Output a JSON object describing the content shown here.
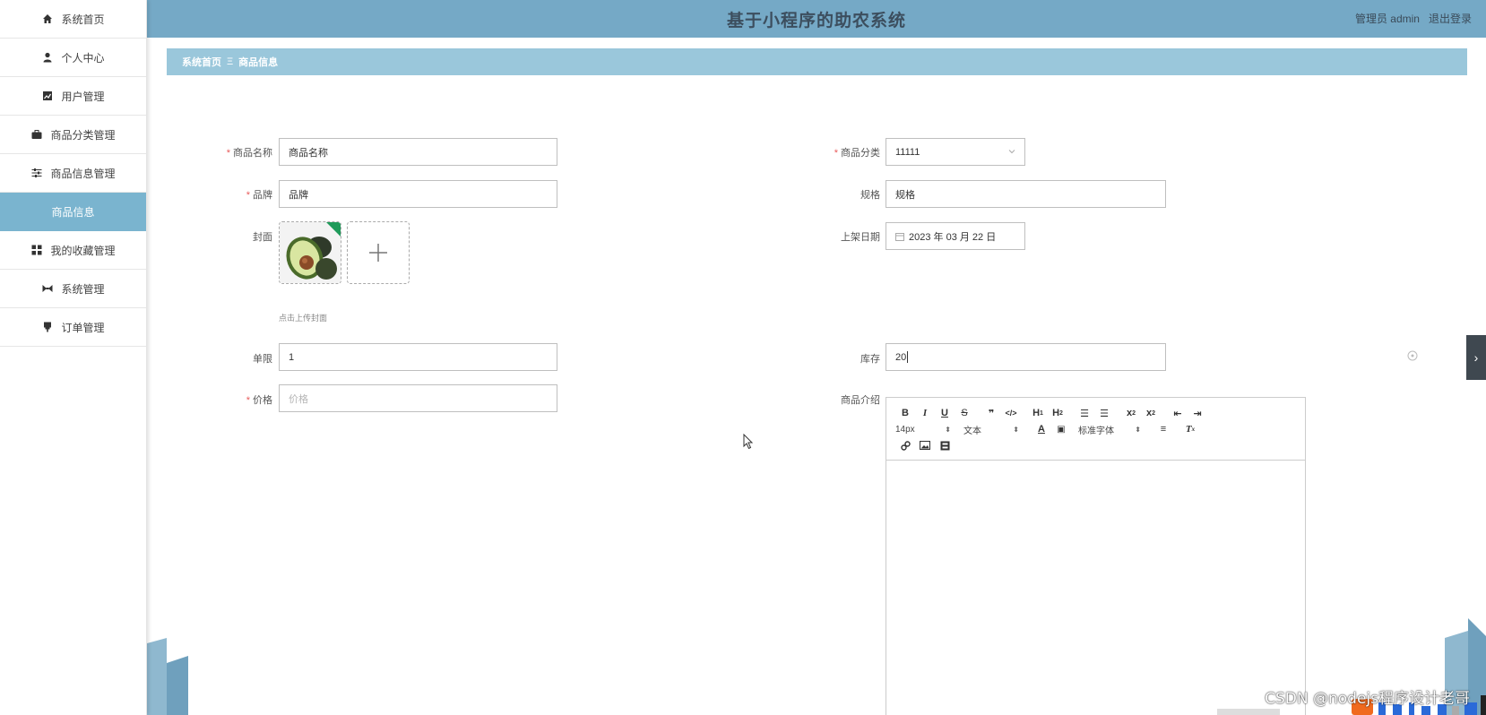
{
  "app": {
    "title": "基于小程序的助农系统",
    "user_label": "管理员 admin",
    "logout_label": "退出登录"
  },
  "sidebar": {
    "items": [
      {
        "label": "系统首页",
        "icon": "home-icon"
      },
      {
        "label": "个人中心",
        "icon": "user-icon"
      },
      {
        "label": "用户管理",
        "icon": "users-icon"
      },
      {
        "label": "商品分类管理",
        "icon": "briefcase-icon"
      },
      {
        "label": "商品信息管理",
        "icon": "sliders-icon"
      },
      {
        "label": "商品信息",
        "icon": "",
        "active": true
      },
      {
        "label": "我的收藏管理",
        "icon": "grid-icon"
      },
      {
        "label": "系统管理",
        "icon": "settings-icon"
      },
      {
        "label": "订单管理",
        "icon": "pin-icon"
      }
    ]
  },
  "breadcrumb": {
    "home": "系统首页",
    "separator": "Ξ",
    "current": "商品信息"
  },
  "form": {
    "name_label": "商品名称",
    "name_value": "商品名称",
    "category_label": "商品分类",
    "category_value": "11111",
    "brand_label": "品牌",
    "brand_value": "品牌",
    "spec_label": "规格",
    "spec_value": "规格",
    "cover_label": "封面",
    "cover_hint": "点击上传封面",
    "date_label": "上架日期",
    "date_value": "2023 年 03 月 22 日",
    "limit_label": "单限",
    "limit_value": "1",
    "stock_label": "库存",
    "stock_value": "20",
    "price_label": "价格",
    "price_placeholder": "价格",
    "intro_label": "商品介绍"
  },
  "editor": {
    "font_size": "14px",
    "text_style": "文本",
    "font_family": "标准字体"
  },
  "watermark": "CSDN @nodejs程序设计老哥",
  "colors": {
    "header": "#75a9c6",
    "breadcrumb": "#9ac7db",
    "active_item": "#7ab4cf",
    "required": "#e85c5c"
  }
}
